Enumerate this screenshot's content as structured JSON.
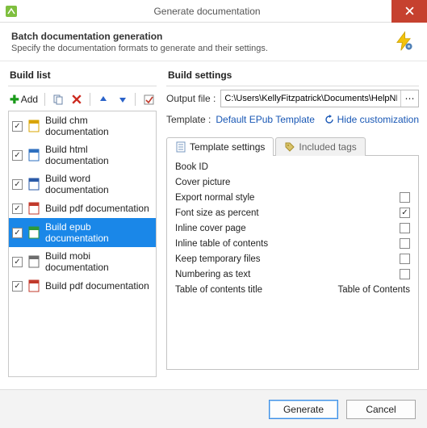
{
  "window": {
    "title": "Generate documentation"
  },
  "header": {
    "title": "Batch documentation generation",
    "subtitle": "Specify the documentation formats to generate and their settings."
  },
  "left": {
    "section": "Build list",
    "add_label": "Add",
    "items": [
      {
        "label": "Build chm documentation",
        "checked": true,
        "color": "#d9a400"
      },
      {
        "label": "Build html documentation",
        "checked": true,
        "color": "#2d6fbf"
      },
      {
        "label": "Build word documentation",
        "checked": true,
        "color": "#2a5aa7"
      },
      {
        "label": "Build pdf documentation",
        "checked": true,
        "color": "#c1392b"
      },
      {
        "label": "Build epub documentation",
        "checked": true,
        "color": "#2e9a3a",
        "selected": true
      },
      {
        "label": "Build mobi documentation",
        "checked": true,
        "color": "#6d6d6d"
      },
      {
        "label": "Build pdf documentation",
        "checked": true,
        "color": "#c1392b"
      }
    ]
  },
  "right": {
    "section": "Build settings",
    "output_label": "Output file :",
    "output_value": "C:\\Users\\KellyFitzpatrick\\Documents\\HelpND",
    "template_label": "Template :",
    "template_value": "Default EPub Template",
    "hide_label": "Hide customization",
    "tabs": {
      "t1": "Template settings",
      "t2": "Included tags"
    },
    "settings": [
      {
        "label": "Book ID",
        "type": "none"
      },
      {
        "label": "Cover picture",
        "type": "none"
      },
      {
        "label": "Export normal style",
        "type": "check",
        "checked": false
      },
      {
        "label": "Font size as percent",
        "type": "check",
        "checked": true
      },
      {
        "label": "Inline cover page",
        "type": "check",
        "checked": false
      },
      {
        "label": "Inline table of contents",
        "type": "check",
        "checked": false
      },
      {
        "label": "Keep temporary files",
        "type": "check",
        "checked": false
      },
      {
        "label": "Numbering as text",
        "type": "check",
        "checked": false
      },
      {
        "label": "Table of contents title",
        "type": "value",
        "value": "Table of Contents"
      }
    ]
  },
  "footer": {
    "generate": "Generate",
    "cancel": "Cancel"
  }
}
